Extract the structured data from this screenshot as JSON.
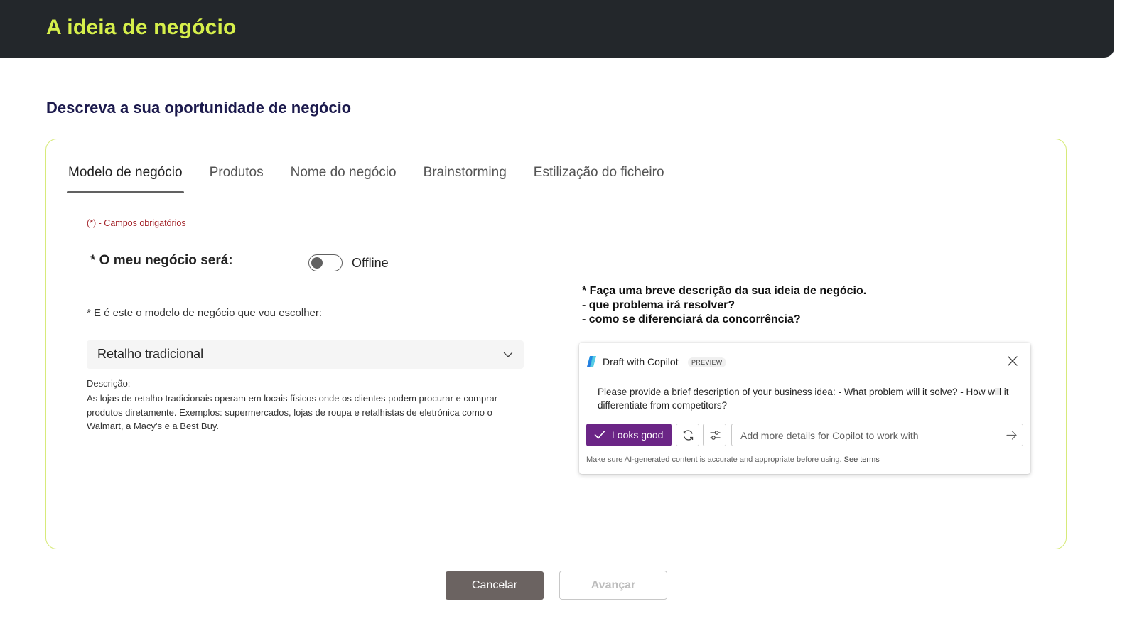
{
  "header": {
    "title": "A ideia de negócio"
  },
  "page": {
    "title": "Descreva a sua oportunidade de negócio"
  },
  "tabs": [
    {
      "label": "Modelo de negócio",
      "active": true
    },
    {
      "label": "Produtos"
    },
    {
      "label": "Nome do negócio"
    },
    {
      "label": "Brainstorming"
    },
    {
      "label": "Estilização do ficheiro"
    }
  ],
  "form": {
    "required_note": "(*) - Campos obrigatórios",
    "business_type": {
      "label": "* O meu negócio será:",
      "toggle_state": "Offline",
      "toggle_on": false
    },
    "model": {
      "label": "* E é este o modelo de negócio que vou escolher:",
      "selected": "Retalho tradicional",
      "description_label": "Descrição:",
      "description": "As lojas de retalho tradicionais operam em locais físicos onde os clientes podem procurar e comprar produtos diretamente. Exemplos: supermercados, lojas de roupa e retalhistas de eletrónica como o Walmart, a Macy's e a Best Buy."
    },
    "idea_prompt": {
      "line1": "* Faça uma breve descrição da sua ideia de negócio.",
      "line2": "- que problema irá resolver?",
      "line3": "- como se diferenciará da concorrência?"
    }
  },
  "copilot": {
    "title": "Draft with Copilot",
    "badge": "PREVIEW",
    "message": "Please provide a brief description of your business idea: - What problem will it solve? - How will it differentiate from competitors?",
    "looks_good_label": "Looks good",
    "input_placeholder": "Add more details for Copilot to work with",
    "disclaimer": "Make sure AI-generated content is accurate and appropriate before using.",
    "terms_link": "See terms"
  },
  "actions": {
    "cancel_label": "Cancelar",
    "next_label": "Avançar"
  },
  "colors": {
    "header_bg": "#23272b",
    "header_title": "#d6ef4b",
    "card_border": "#d7ea7a",
    "copilot_primary": "#6b2586",
    "cancel_button": "#6b6361",
    "required_text": "#a4262c"
  },
  "icons": {
    "dropdown": "chevron-down-icon",
    "copilot": "copilot-logo-icon",
    "close": "close-icon",
    "check": "checkmark-icon",
    "regenerate": "refresh-icon",
    "adjust": "sliders-icon",
    "send": "arrow-right-icon"
  }
}
